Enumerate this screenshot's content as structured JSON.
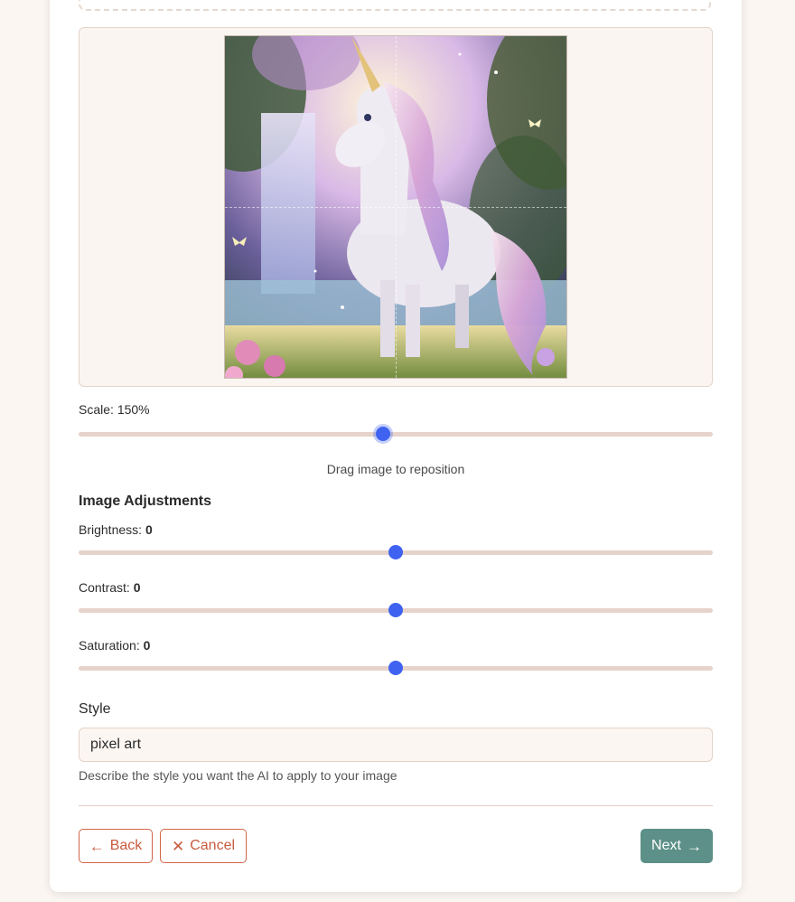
{
  "crop": {
    "scale_label": "Scale:",
    "scale_value": "150%",
    "scale_fraction": 0.48,
    "hint": "Drag image to reposition"
  },
  "adjustments": {
    "title": "Image Adjustments",
    "brightness": {
      "label": "Brightness:",
      "value": "0",
      "fraction": 0.5
    },
    "contrast": {
      "label": "Contrast:",
      "value": "0",
      "fraction": 0.5
    },
    "saturation": {
      "label": "Saturation:",
      "value": "0",
      "fraction": 0.5
    }
  },
  "style": {
    "title": "Style",
    "input_value": "pixel art",
    "help": "Describe the style you want the AI to apply to your image"
  },
  "buttons": {
    "back": "Back",
    "cancel": "Cancel",
    "next": "Next"
  },
  "icons": {
    "back": "arrow-left-icon",
    "cancel": "close-icon",
    "next": "arrow-right-icon"
  },
  "colors": {
    "accent": "#3f63f0",
    "danger": "#c85a3f",
    "primary": "#5c9088"
  }
}
